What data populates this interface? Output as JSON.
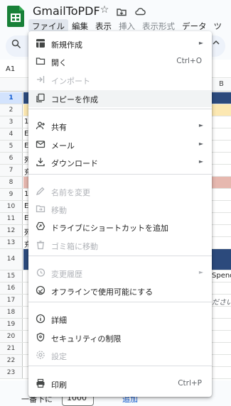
{
  "app": {
    "title": "GmailToPDF",
    "title_icons": [
      "star-icon",
      "move-icon",
      "cloud-status-icon"
    ]
  },
  "menubar": {
    "items": [
      {
        "label": "ファイル",
        "state": "active"
      },
      {
        "label": "編集",
        "state": "normal"
      },
      {
        "label": "表示",
        "state": "normal"
      },
      {
        "label": "挿入",
        "state": "disabled"
      },
      {
        "label": "表示形式",
        "state": "disabled"
      },
      {
        "label": "データ",
        "state": "normal"
      },
      {
        "label": "ツ",
        "state": "normal"
      }
    ]
  },
  "toolbar": {
    "search_icon": "search-icon",
    "expand_icon": "chevron-up-icon"
  },
  "formula_bar": {
    "cell_ref": "A1"
  },
  "grid": {
    "column_header": "B",
    "rows": [
      {
        "num": "1",
        "selected": true,
        "fill": "#2c4a7c",
        "text": "",
        "right": ""
      },
      {
        "num": "2",
        "fill": "#fce8b2",
        "text": "",
        "right": ""
      },
      {
        "num": "3",
        "text": "1",
        "right": ""
      },
      {
        "num": "4",
        "text": "E",
        "right": ""
      },
      {
        "num": "5",
        "text": "E",
        "right": ""
      },
      {
        "num": "6",
        "text": "死",
        "right": ""
      },
      {
        "num": "7",
        "text": "充",
        "right": ""
      },
      {
        "num": "8",
        "fill": "#e6b8af",
        "text": "",
        "right": ""
      },
      {
        "num": "9",
        "text": "1",
        "right": ""
      },
      {
        "num": "10",
        "text": "E",
        "right": ""
      },
      {
        "num": "11",
        "text": "E",
        "right": ""
      },
      {
        "num": "12",
        "text": "死",
        "right": ""
      },
      {
        "num": "13",
        "text": "充",
        "right": ""
      },
      {
        "num": "14",
        "tall": true,
        "fill": "#2c4a7c",
        "text": "",
        "right": ""
      },
      {
        "num": "15",
        "text": "",
        "right": "Spend"
      },
      {
        "num": "16",
        "text": "",
        "right": ""
      },
      {
        "num": "17",
        "text": "",
        "right": "ださい",
        "italic": true
      },
      {
        "num": "18",
        "text": "",
        "right": ""
      },
      {
        "num": "19",
        "text": "",
        "right": ""
      },
      {
        "num": "20",
        "text": "",
        "right": ""
      },
      {
        "num": "21",
        "text": "",
        "right": ""
      },
      {
        "num": "22",
        "text": "",
        "right": ""
      },
      {
        "num": "23",
        "text": "",
        "right": ""
      }
    ]
  },
  "bottom_bar": {
    "prefix_text": "一番下に",
    "input_value": "1000",
    "link_text": "追加"
  },
  "file_menu": {
    "items": [
      {
        "label": "新規作成",
        "icon": "new-sheet-icon",
        "submenu": true
      },
      {
        "label": "開く",
        "icon": "folder-icon",
        "shortcut": "Ctrl+O"
      },
      {
        "label": "インポート",
        "icon": "import-icon",
        "disabled": true
      },
      {
        "label": "コピーを作成",
        "icon": "copy-icon",
        "hover": true
      },
      {
        "label": "共有",
        "icon": "share-person-icon",
        "submenu": true
      },
      {
        "label": "メール",
        "icon": "mail-icon",
        "submenu": true
      },
      {
        "label": "ダウンロード",
        "icon": "download-icon",
        "submenu": true
      },
      {
        "label": "名前を変更",
        "icon": "pencil-icon",
        "disabled": true
      },
      {
        "label": "移動",
        "icon": "move-folder-icon",
        "disabled": true
      },
      {
        "label": "ドライブにショートカットを追加",
        "icon": "drive-shortcut-icon"
      },
      {
        "label": "ゴミ箱に移動",
        "icon": "trash-icon",
        "disabled": true
      },
      {
        "label": "変更履歴",
        "icon": "history-icon",
        "submenu": true,
        "disabled": true
      },
      {
        "label": "オフラインで使用可能にする",
        "icon": "offline-icon"
      },
      {
        "label": "詳細",
        "icon": "info-icon"
      },
      {
        "label": "セキュリティの制限",
        "icon": "security-icon"
      },
      {
        "label": "設定",
        "icon": "settings-icon",
        "disabled": true
      },
      {
        "label": "印刷",
        "icon": "print-icon",
        "shortcut": "Ctrl+P"
      }
    ]
  }
}
